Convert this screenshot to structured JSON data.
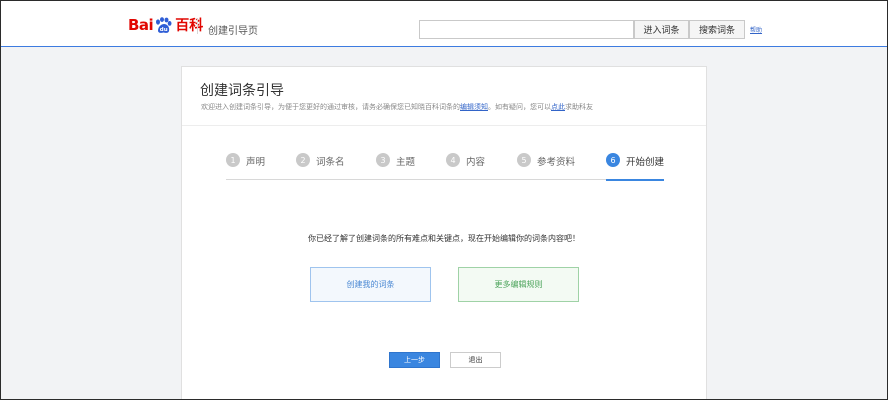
{
  "header": {
    "logo": {
      "bai": "Bai",
      "du": "du",
      "baike": "百科"
    },
    "page_name": "创建引导页",
    "search": {
      "value": "",
      "placeholder": ""
    },
    "enter_button": "进入词条",
    "search_button": "搜索词条",
    "help_link": "帮助"
  },
  "card": {
    "title": "创建词条引导",
    "desc_prefix": "欢迎进入创建词条引导，为便于您更好的通过审核，请务必确保您已知晓百科词条的",
    "desc_link1": "编辑须知",
    "desc_middle": "。如有疑问，您可以",
    "desc_link2": "点此",
    "desc_suffix": "求助科友"
  },
  "steps": [
    {
      "num": "1",
      "label": "声明"
    },
    {
      "num": "2",
      "label": "词条名"
    },
    {
      "num": "3",
      "label": "主题"
    },
    {
      "num": "4",
      "label": "内容"
    },
    {
      "num": "5",
      "label": "参考资料"
    },
    {
      "num": "6",
      "label": "开始创建"
    }
  ],
  "active_step": 6,
  "message": "你已经了解了创建词条的所有难点和关键点，现在开始编辑你的词条内容吧！",
  "buttons": {
    "create": "创建我的词条",
    "rules": "更多编辑规则",
    "prev": "上一步",
    "exit": "退出"
  },
  "colors": {
    "brand_red": "#e10601",
    "accent_blue": "#3a86e0",
    "green": "#4ba35a"
  }
}
